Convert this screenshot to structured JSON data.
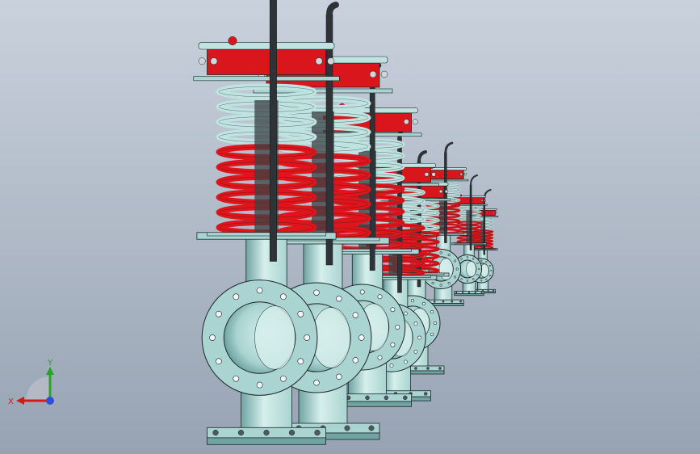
{
  "viewport": {
    "background_top": "#c9d1dc",
    "background_bottom": "#97a3b3"
  },
  "model": {
    "valve_count": 7,
    "colors": {
      "body": "#a9d4d1",
      "body_dark": "#6fa4a2",
      "body_light": "#d6efec",
      "spring_red": "#e0141b",
      "spring_light": "#bfe3e0",
      "cap_red": "#d8161c",
      "stem": "#2e3338",
      "outline": "#1e2628"
    }
  },
  "triad": {
    "x_label": "X",
    "y_label": "Y",
    "x_color": "#d61a1a",
    "y_color": "#27a327",
    "z_color": "#2f4fd8"
  }
}
